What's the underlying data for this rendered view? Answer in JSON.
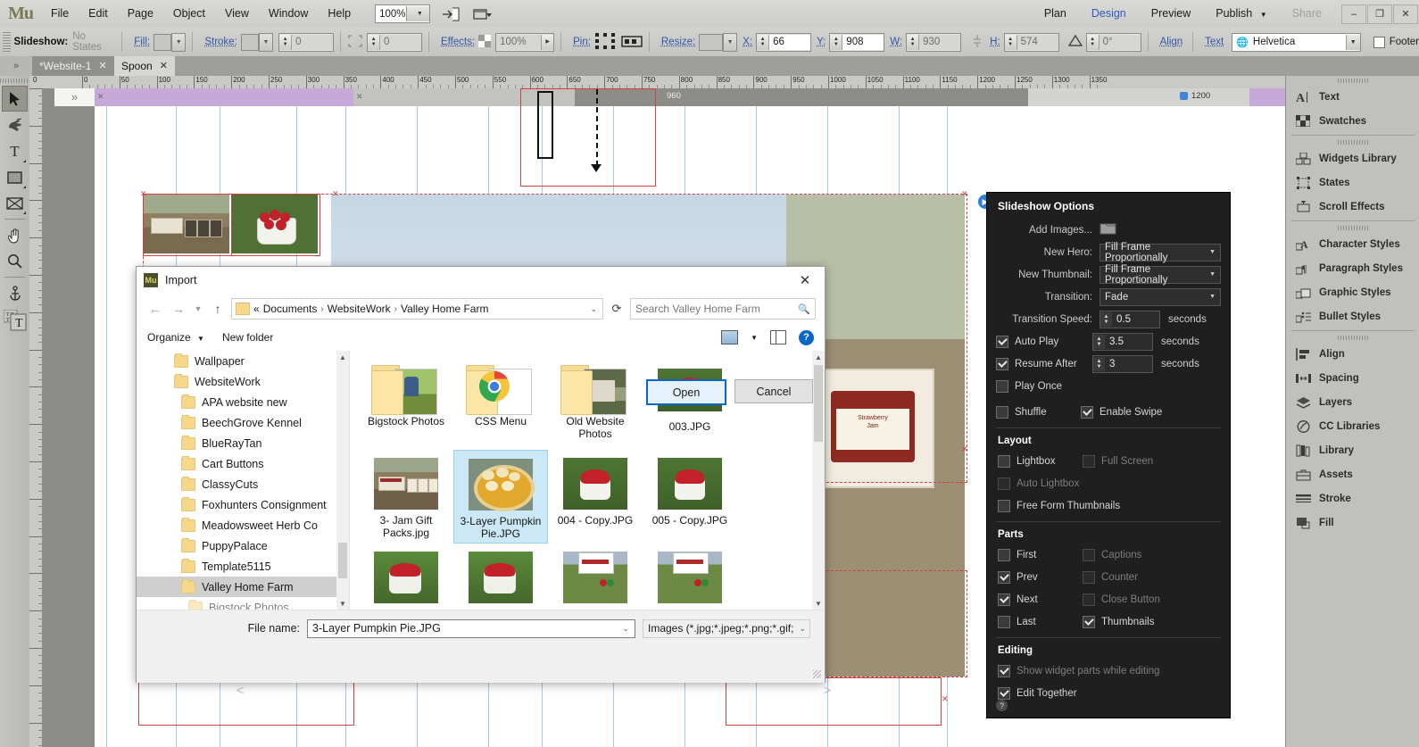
{
  "app": {
    "logo": "Mu",
    "menus": [
      "File",
      "Edit",
      "Page",
      "Object",
      "View",
      "Window",
      "Help"
    ],
    "zoom": "100%",
    "modes": [
      "Plan",
      "Design",
      "Preview",
      "Publish"
    ],
    "share": "Share",
    "active_mode": "Design",
    "window_controls": [
      "–",
      "❐",
      "✕"
    ]
  },
  "control_bar": {
    "context_label": "Slideshow:",
    "states": "No States",
    "fill": "Fill:",
    "stroke": "Stroke:",
    "stroke_weight": "0",
    "corner_radius": "0",
    "effects": "Effects:",
    "opacity": "100%",
    "pin": "Pin:",
    "resize": "Resize:",
    "x_label": "X:",
    "x_value": "66",
    "y_label": "Y:",
    "y_value": "908",
    "w_label": "W:",
    "w_value": "930",
    "h_label": "H:",
    "h_value": "574",
    "rotation": "0°",
    "align": "Align",
    "text": "Text",
    "font": "Helvetica",
    "footer": "Footer"
  },
  "tabs": [
    {
      "label": "*Website-1",
      "active": false
    },
    {
      "label": "Spoon",
      "active": true
    }
  ],
  "tools": [
    {
      "name": "selection-tool",
      "glyph": "➤",
      "selected": true
    },
    {
      "name": "crop-tool",
      "glyph": "✋",
      "selected": false
    },
    {
      "name": "text-tool",
      "glyph": "T",
      "selected": false
    },
    {
      "name": "rectangle-tool",
      "glyph": "■",
      "selected": false
    },
    {
      "name": "image-frame-tool",
      "glyph": "⌧",
      "selected": false
    },
    {
      "name": "hand-tool",
      "glyph": "✋",
      "selected": false
    },
    {
      "name": "zoom-tool",
      "glyph": "⚲",
      "selected": false
    },
    {
      "name": "anchor-tool",
      "glyph": "⚓",
      "selected": false
    },
    {
      "name": "type-tool",
      "glyph": "T",
      "selected": false
    }
  ],
  "ruler": {
    "h_labels": [
      "0",
      "0",
      "50",
      "100",
      "150",
      "200",
      "250",
      "300",
      "350",
      "400",
      "450",
      "500",
      "550",
      "600",
      "650",
      "700",
      "750",
      "800",
      "850",
      "900",
      "950",
      "1000",
      "1050",
      "1100",
      "1150",
      "1200",
      "1250",
      "1300",
      "13"
    ],
    "breakpoint_960": "960",
    "breakpoint_1200": "1200"
  },
  "right_dock": {
    "groups": [
      [
        {
          "label": "Text",
          "icon": "text-panel-icon"
        },
        {
          "label": "Swatches",
          "icon": "swatches-panel-icon"
        }
      ],
      [
        {
          "label": "Widgets Library",
          "icon": "widgets-library-icon"
        },
        {
          "label": "States",
          "icon": "states-panel-icon"
        },
        {
          "label": "Scroll Effects",
          "icon": "scroll-effects-icon"
        }
      ],
      [
        {
          "label": "Character Styles",
          "icon": "character-styles-icon"
        },
        {
          "label": "Paragraph Styles",
          "icon": "paragraph-styles-icon"
        },
        {
          "label": "Graphic Styles",
          "icon": "graphic-styles-icon"
        },
        {
          "label": "Bullet Styles",
          "icon": "bullet-styles-icon"
        }
      ],
      [
        {
          "label": "Align",
          "icon": "align-panel-icon"
        },
        {
          "label": "Spacing",
          "icon": "spacing-panel-icon"
        },
        {
          "label": "Layers",
          "icon": "layers-panel-icon"
        },
        {
          "label": "CC Libraries",
          "icon": "cc-libraries-icon"
        },
        {
          "label": "Library",
          "icon": "library-panel-icon"
        },
        {
          "label": "Assets",
          "icon": "assets-panel-icon"
        },
        {
          "label": "Stroke",
          "icon": "stroke-panel-icon"
        },
        {
          "label": "Fill",
          "icon": "fill-panel-icon"
        }
      ]
    ]
  },
  "slideshow_options": {
    "title": "Slideshow Options",
    "add_images_label": "Add Images...",
    "new_hero_label": "New Hero:",
    "new_hero_value": "Fill Frame Proportionally",
    "new_thumbnail_label": "New Thumbnail:",
    "new_thumbnail_value": "Fill Frame Proportionally",
    "transition_label": "Transition:",
    "transition_value": "Fade",
    "transition_speed_label": "Transition Speed:",
    "transition_speed_value": "0.5",
    "seconds": "seconds",
    "auto_play_label": "Auto Play",
    "auto_play_checked": true,
    "auto_play_value": "3.5",
    "resume_after_label": "Resume After",
    "resume_after_checked": true,
    "resume_after_value": "3",
    "play_once_label": "Play Once",
    "play_once_checked": false,
    "shuffle_label": "Shuffle",
    "shuffle_checked": false,
    "enable_swipe_label": "Enable Swipe",
    "enable_swipe_checked": true,
    "layout_heading": "Layout",
    "lightbox_label": "Lightbox",
    "lightbox_checked": false,
    "full_screen_label": "Full Screen",
    "full_screen_checked": false,
    "auto_lightbox_label": "Auto Lightbox",
    "auto_lightbox_checked": false,
    "free_form_thumbnails_label": "Free Form Thumbnails",
    "free_form_thumbnails_checked": false,
    "parts_heading": "Parts",
    "first_label": "First",
    "first_checked": false,
    "captions_label": "Captions",
    "captions_checked": false,
    "prev_label": "Prev",
    "prev_checked": true,
    "counter_label": "Counter",
    "counter_checked": false,
    "next_label": "Next",
    "next_checked": true,
    "close_button_label": "Close Button",
    "close_button_checked": false,
    "last_label": "Last",
    "last_checked": false,
    "thumbnails_label": "Thumbnails",
    "thumbnails_checked": true,
    "editing_heading": "Editing",
    "show_widget_parts_label": "Show widget parts while editing",
    "show_widget_parts_checked": true,
    "edit_together_label": "Edit Together",
    "edit_together_checked": true,
    "help_glyph": "?"
  },
  "import_dialog": {
    "title": "Import",
    "close_glyph": "✕",
    "breadcrumb": {
      "prefix": "«",
      "items": [
        "Documents",
        "WebsiteWork",
        "Valley Home Farm"
      ],
      "separator": "›"
    },
    "search_placeholder": "Search Valley Home Farm",
    "organize_label": "Organize",
    "new_folder_label": "New folder",
    "help_glyph": "?",
    "tree": [
      {
        "label": "Wallpaper",
        "indent": 1,
        "selected": false
      },
      {
        "label": "WebsiteWork",
        "indent": 1,
        "selected": false
      },
      {
        "label": "APA website new",
        "indent": 2,
        "selected": false
      },
      {
        "label": "BeechGrove Kennel",
        "indent": 2,
        "selected": false
      },
      {
        "label": "BlueRayTan",
        "indent": 2,
        "selected": false
      },
      {
        "label": "Cart Buttons",
        "indent": 2,
        "selected": false
      },
      {
        "label": "ClassyCuts",
        "indent": 2,
        "selected": false
      },
      {
        "label": "Foxhunters Consignment",
        "indent": 2,
        "selected": false
      },
      {
        "label": "Meadowsweet Herb Co",
        "indent": 2,
        "selected": false
      },
      {
        "label": "PuppyPalace",
        "indent": 2,
        "selected": false
      },
      {
        "label": "Template5115",
        "indent": 2,
        "selected": false
      },
      {
        "label": "Valley Home Farm",
        "indent": 2,
        "selected": true
      },
      {
        "label": "Bigstock Photos",
        "indent": 3,
        "selected": false
      }
    ],
    "files": [
      {
        "name": "Bigstock Photos",
        "type": "folder",
        "kind": "photo-boy",
        "selected": false
      },
      {
        "name": "CSS Menu",
        "type": "folder",
        "kind": "chrome",
        "selected": false
      },
      {
        "name": "Old Website Photos",
        "type": "folder",
        "kind": "photo-house",
        "selected": false
      },
      {
        "name": "003.JPG",
        "type": "image",
        "kind": "berries",
        "selected": false
      },
      {
        "name": "3- Jam Gift Packs.jpg",
        "type": "image",
        "kind": "jam",
        "selected": false
      },
      {
        "name": "3-Layer Pumpkin Pie.JPG",
        "type": "image",
        "kind": "pie",
        "selected": true
      },
      {
        "name": "004 - Copy.JPG",
        "type": "image",
        "kind": "berries",
        "selected": false
      },
      {
        "name": "005 - Copy.JPG",
        "type": "image",
        "kind": "berries",
        "selected": false
      },
      {
        "name": "",
        "type": "image",
        "kind": "berries2",
        "selected": false
      },
      {
        "name": "",
        "type": "image",
        "kind": "berries2",
        "selected": false
      },
      {
        "name": "",
        "type": "image",
        "kind": "sign",
        "selected": false
      },
      {
        "name": "",
        "type": "image",
        "kind": "sign",
        "selected": false
      }
    ],
    "file_name_label": "File name:",
    "file_name_value": "3-Layer Pumpkin Pie.JPG",
    "filter_value": "Images (*.jpg;*.jpeg;*.png;*.gif;",
    "open_label": "Open",
    "cancel_label": "Cancel"
  },
  "canvas": {
    "prev_arrow": "<",
    "next_arrow": ">",
    "chevron": "»"
  },
  "colors": {
    "accent_blue": "#2f7fd6",
    "selection_red": "#d1403f",
    "guide_blue": "#a8c8e8",
    "panel_dark": "#1f1f1f",
    "breakpoint_purple": "#c6a9d8",
    "folder_yellow": "#f6d88a",
    "selected_file_blue": "#cce8f7"
  }
}
